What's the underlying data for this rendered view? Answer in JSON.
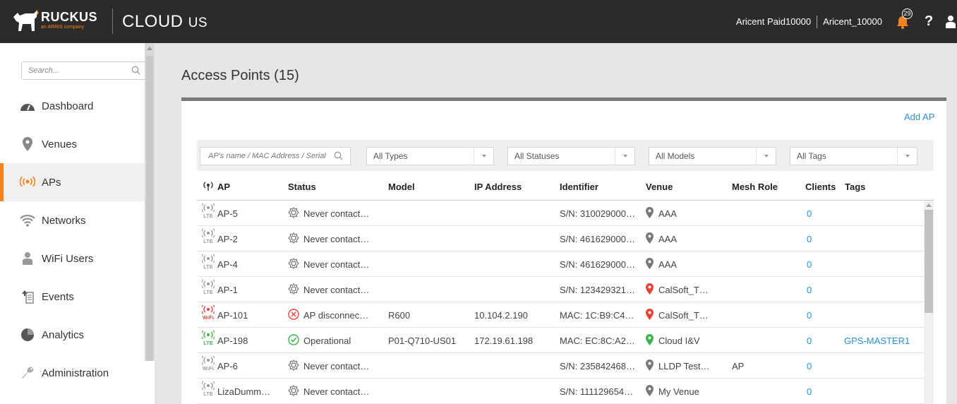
{
  "header": {
    "brand": "RUCKUS",
    "brand_sub": "an ARRIS company",
    "product": "CLOUD",
    "region": "US",
    "account_name": "Aricent Paid10000",
    "tenant_name": "Aricent_10000",
    "notification_count": "29",
    "help_label": "?",
    "accent_color": "#f58220"
  },
  "sidebar": {
    "search_placeholder": "Search...",
    "items": [
      {
        "label": "Dashboard",
        "icon": "dashboard-icon"
      },
      {
        "label": "Venues",
        "icon": "location-pin-icon"
      },
      {
        "label": "APs",
        "icon": "access-point-icon",
        "active": true
      },
      {
        "label": "Networks",
        "icon": "wifi-icon"
      },
      {
        "label": "WiFi Users",
        "icon": "user-icon"
      },
      {
        "label": "Events",
        "icon": "events-icon"
      },
      {
        "label": "Analytics",
        "icon": "pie-chart-icon"
      },
      {
        "label": "Administration",
        "icon": "wrench-icon"
      }
    ]
  },
  "main": {
    "title": "Access Points (15)",
    "add_ap_label": "Add AP",
    "filters": {
      "search_placeholder": "AP's name / MAC Address / Serial",
      "types": "All Types",
      "statuses": "All Statuses",
      "models": "All Models",
      "tags": "All Tags"
    },
    "columns": [
      "AP",
      "Status",
      "Model",
      "IP Address",
      "Identifier",
      "Venue",
      "Mesh Role",
      "Clients",
      "Tags"
    ],
    "rows": [
      {
        "ap": "AP-5",
        "ap_type": "LTE",
        "ap_color": "#999999",
        "status": "Never contact…",
        "status_kind": "never",
        "model": "",
        "ip": "",
        "identifier": "S/N: 310029000…",
        "venue": "AAA",
        "venue_color": "#777777",
        "mesh_role": "",
        "clients": "0",
        "tags": ""
      },
      {
        "ap": "AP-2",
        "ap_type": "LTE",
        "ap_color": "#999999",
        "status": "Never contact…",
        "status_kind": "never",
        "model": "",
        "ip": "",
        "identifier": "S/N: 461629000…",
        "venue": "AAA",
        "venue_color": "#777777",
        "mesh_role": "",
        "clients": "0",
        "tags": ""
      },
      {
        "ap": "AP-4",
        "ap_type": "LTE",
        "ap_color": "#999999",
        "status": "Never contact…",
        "status_kind": "never",
        "model": "",
        "ip": "",
        "identifier": "S/N: 461629000…",
        "venue": "AAA",
        "venue_color": "#777777",
        "mesh_role": "",
        "clients": "0",
        "tags": ""
      },
      {
        "ap": "AP-1",
        "ap_type": "LTE",
        "ap_color": "#999999",
        "status": "Never contact…",
        "status_kind": "never",
        "model": "",
        "ip": "",
        "identifier": "S/N: 123429321…",
        "venue": "CalSoft_T…",
        "venue_color": "#e8403a",
        "mesh_role": "",
        "clients": "0",
        "tags": ""
      },
      {
        "ap": "AP-101",
        "ap_type": "WiFi",
        "ap_color": "#e8403a",
        "status": "AP disconnec…",
        "status_kind": "disconnected",
        "model": "R600",
        "ip": "10.104.2.190",
        "identifier": "MAC: 1C:B9:C4…",
        "venue": "CalSoft_T…",
        "venue_color": "#e8403a",
        "mesh_role": "",
        "clients": "0",
        "tags": ""
      },
      {
        "ap": "AP-198",
        "ap_type": "LTE",
        "ap_color": "#3bb54a",
        "status": "Operational",
        "status_kind": "operational",
        "model": "P01-Q710-US01",
        "ip": "172.19.61.198",
        "identifier": "MAC: EC:8C:A2…",
        "venue": "Cloud I&V",
        "venue_color": "#3bb54a",
        "mesh_role": "",
        "clients": "0",
        "tags": "GPS-MASTER1"
      },
      {
        "ap": "AP-6",
        "ap_type": "WiFi",
        "ap_color": "#999999",
        "status": "Never contact…",
        "status_kind": "never",
        "model": "",
        "ip": "",
        "identifier": "S/N: 235842468…",
        "venue": "LLDP Test…",
        "venue_color": "#777777",
        "mesh_role": "AP",
        "clients": "0",
        "tags": ""
      },
      {
        "ap": "LizaDumm…",
        "ap_type": "LTE",
        "ap_color": "#999999",
        "status": "Never contact…",
        "status_kind": "never",
        "model": "",
        "ip": "",
        "identifier": "S/N: 111129654…",
        "venue": "My Venue",
        "venue_color": "#777777",
        "mesh_role": "",
        "clients": "0",
        "tags": ""
      }
    ]
  }
}
